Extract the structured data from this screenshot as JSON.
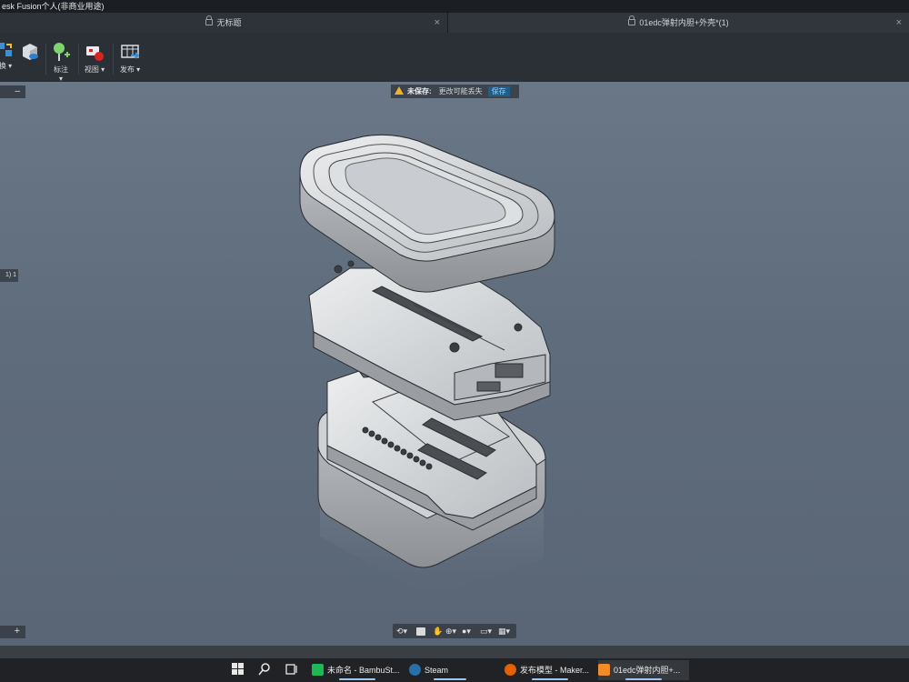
{
  "window": {
    "title": "esk Fusion个人(非商业用途)"
  },
  "tabs": [
    {
      "label": "无标题",
      "close": "×"
    },
    {
      "label": "01edc弹射内胆+外壳*(1)",
      "close": "×"
    }
  ],
  "toolbar": {
    "items": [
      {
        "label": "换 ▾",
        "icon": "switch-icon"
      },
      {
        "label": "",
        "icon": "box-view-icon"
      },
      {
        "label": "标注 ▾",
        "icon": "annotate-icon"
      },
      {
        "label": "视图 ▾",
        "icon": "view-camera-icon"
      },
      {
        "label": "发布 ▾",
        "icon": "publish-icon"
      }
    ]
  },
  "browser": {
    "collapse": "–",
    "node_label": "1) 1",
    "add": "+"
  },
  "unsaved_bar": {
    "label": "未保存:",
    "message": "更改可能丢失",
    "action": "保存"
  },
  "navbar": {
    "items": [
      "⟲▾",
      "✋",
      "⊕▾",
      "●▾",
      "▭▾",
      "▦▾"
    ]
  },
  "taskbar": {
    "apps": [
      {
        "label": "未命名 - BambuSt...",
        "color": "#1db954"
      },
      {
        "label": "Steam",
        "color": "#1b2838"
      },
      {
        "label": "发布模型 - Maker...",
        "color": "#e66000"
      },
      {
        "label": "01edc弹射内胆+...",
        "color": "#f28c28"
      }
    ]
  },
  "colors": {
    "accent": "#1d5e8a",
    "warning": "#f0b429",
    "viewport": "#5f6c7c"
  }
}
